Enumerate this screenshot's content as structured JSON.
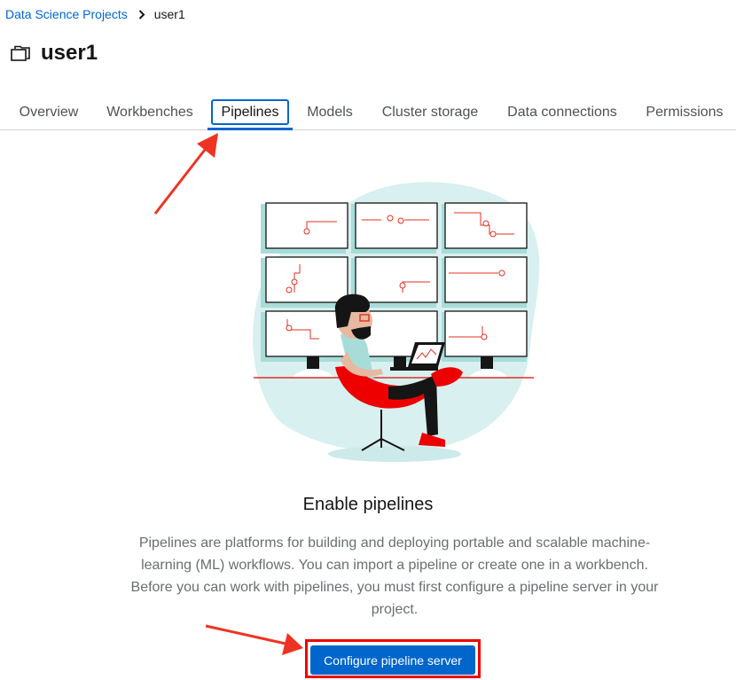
{
  "breadcrumb": {
    "parent": "Data Science Projects",
    "current": "user1"
  },
  "page": {
    "title": "user1"
  },
  "tabs": [
    {
      "label": "Overview",
      "active": false
    },
    {
      "label": "Workbenches",
      "active": false
    },
    {
      "label": "Pipelines",
      "active": true
    },
    {
      "label": "Models",
      "active": false
    },
    {
      "label": "Cluster storage",
      "active": false
    },
    {
      "label": "Data connections",
      "active": false
    },
    {
      "label": "Permissions",
      "active": false
    }
  ],
  "empty_state": {
    "title": "Enable pipelines",
    "body": "Pipelines are platforms for building and deploying portable and scalable machine-learning (ML) workflows. You can import a pipeline or create one in a workbench. Before you can work with pipelines, you must first configure a pipeline server in your project.",
    "button_label": "Configure pipeline server"
  },
  "colors": {
    "link": "#0066cc",
    "primary_button": "#0066cc",
    "annotation_red": "#ee3322",
    "illustration_teal": "#d8f0ef"
  },
  "icons": {
    "breadcrumb_separator": "chevron-right-icon",
    "project": "folder-icon"
  }
}
